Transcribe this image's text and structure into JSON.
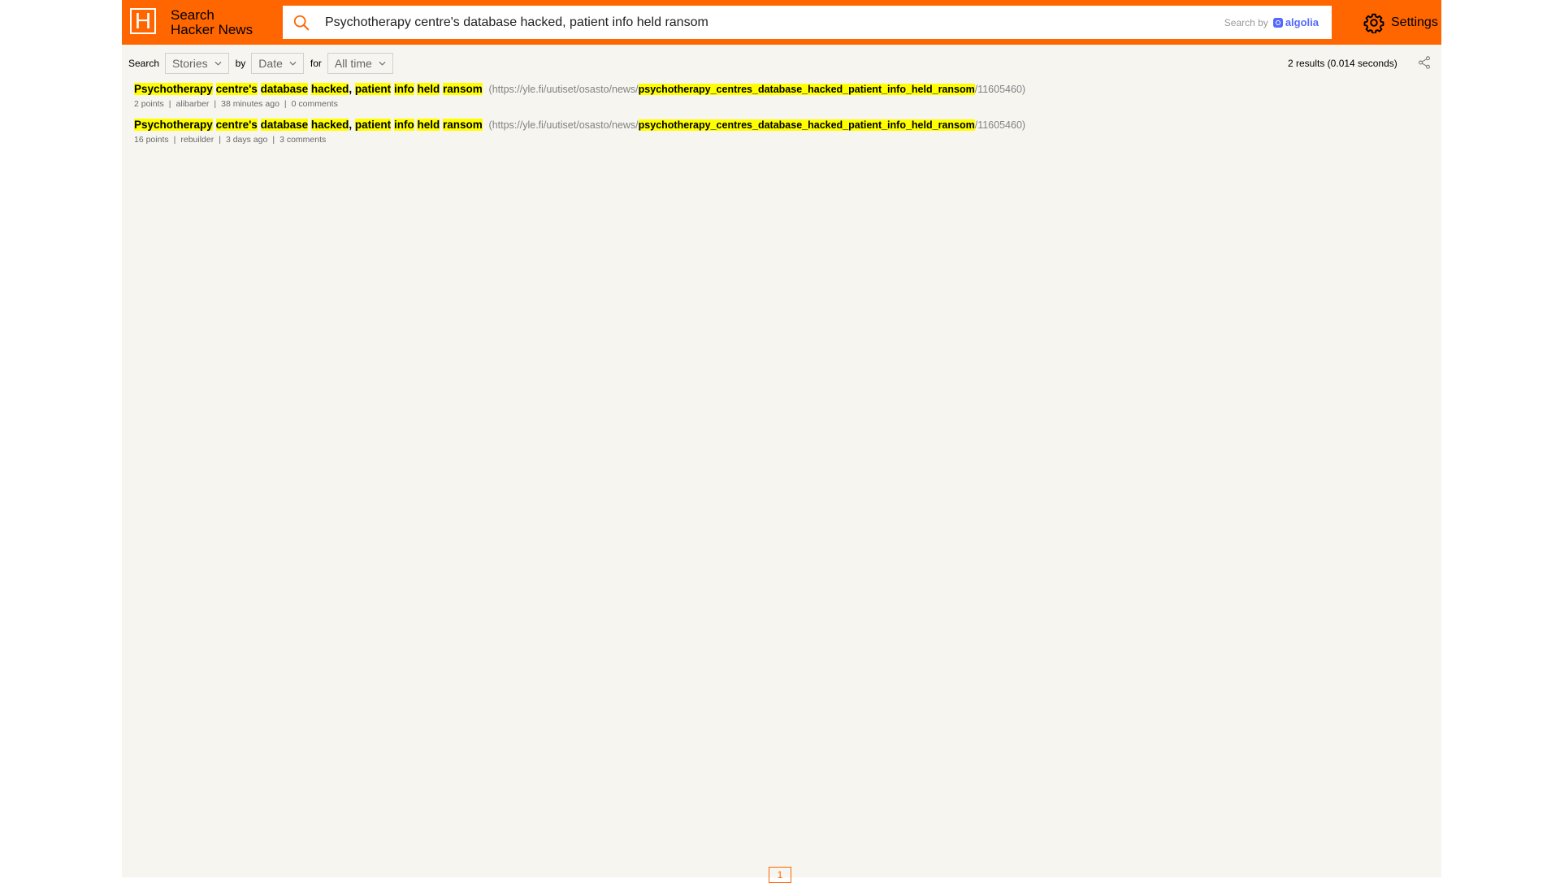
{
  "header": {
    "logo_letter": "H",
    "brand_line1": "Search",
    "brand_line2": "Hacker News",
    "search_value": "Psychotherapy centre's database hacked, patient info held ransom",
    "search_by_label": "Search by",
    "algolia_label": "algolia",
    "settings_label": "Settings",
    "accent_color": "#ff6600"
  },
  "filters": {
    "search_label": "Search",
    "type_value": "Stories",
    "by_label": "by",
    "sort_value": "Date",
    "for_label": "for",
    "range_value": "All time"
  },
  "stats": "2 results (0.014 seconds)",
  "results": [
    {
      "title_words": [
        "Psychotherapy",
        "centre's",
        "database",
        "hacked",
        "patient",
        "info",
        "held",
        "ransom"
      ],
      "url_prefix": "(https://yle.fi/uutiset/osasto/news/",
      "url_highlight": "psychotherapy_centres_database_hacked_patient_info_held_ransom",
      "url_suffix": "/11605460)",
      "points": "2 points",
      "author": "alibarber",
      "time": "38 minutes ago",
      "comments": "0 comments"
    },
    {
      "title_words": [
        "Psychotherapy",
        "centre's",
        "database",
        "hacked",
        "patient",
        "info",
        "held",
        "ransom"
      ],
      "url_prefix": "(https://yle.fi/uutiset/osasto/news/",
      "url_highlight": "psychotherapy_centres_database_hacked_patient_info_held_ransom",
      "url_suffix": "/11605460)",
      "points": "16 points",
      "author": "rebuilder",
      "time": "3 days ago",
      "comments": "3 comments"
    }
  ],
  "pagination": {
    "current_page": "1"
  }
}
